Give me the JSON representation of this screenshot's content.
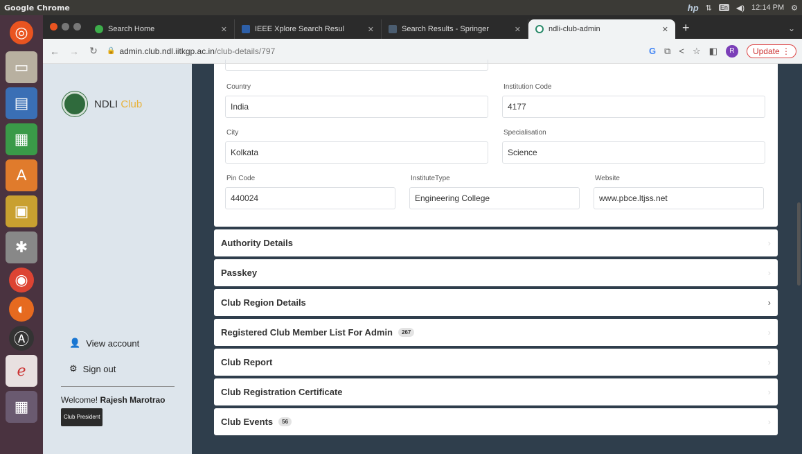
{
  "system": {
    "title": "Google Chrome",
    "time": "12:14 PM",
    "kb": "En",
    "hp": "hp"
  },
  "browser": {
    "tabs": [
      {
        "label": "Search Home",
        "color": "#3dae4b"
      },
      {
        "label": "IEEE Xplore Search Resul",
        "color": "#2d5fa8"
      },
      {
        "label": "Search Results - Springer",
        "color": "#4b5d70"
      },
      {
        "label": "ndli-club-admin",
        "color": "#2a8a6a"
      }
    ],
    "url_host": "admin.club.ndl.iitkgp.ac.in",
    "url_path": "/club-details/797",
    "profile_initial": "R",
    "update_label": "Update"
  },
  "sidebar": {
    "brand_main": "NDLI",
    "brand_accent": "Club",
    "view_account": "View account",
    "sign_out": "Sign out",
    "welcome_prefix": "Welcome!",
    "user_name": "Rajesh Marotrao",
    "role": "Club President"
  },
  "form": {
    "country_label": "Country",
    "country_value": "India",
    "institution_code_label": "Institution Code",
    "institution_code_value": "4177",
    "city_label": "City",
    "city_value": "Kolkata",
    "specialisation_label": "Specialisation",
    "specialisation_value": "Science",
    "pin_label": "Pin Code",
    "pin_value": "440024",
    "institute_type_label": "InstituteType",
    "institute_type_value": "Engineering College",
    "website_label": "Website",
    "website_value": "www.pbce.ltjss.net"
  },
  "sections": [
    {
      "title": "Authority Details",
      "badge": ""
    },
    {
      "title": "Passkey",
      "badge": ""
    },
    {
      "title": "Club Region Details",
      "badge": ""
    },
    {
      "title": "Registered Club Member List For Admin",
      "badge": "267"
    },
    {
      "title": "Club Report",
      "badge": ""
    },
    {
      "title": "Club Registration Certificate",
      "badge": ""
    },
    {
      "title": "Club Events",
      "badge": "56"
    }
  ]
}
